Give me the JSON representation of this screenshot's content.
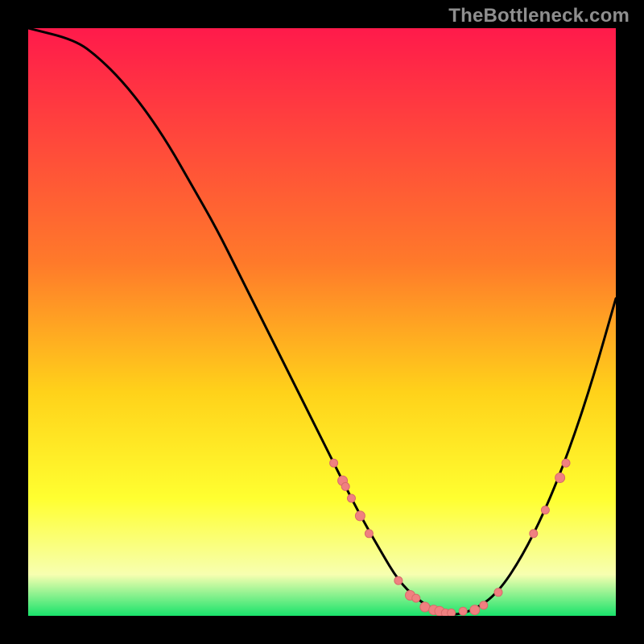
{
  "watermark": "TheBottleneck.com",
  "colors": {
    "gradient_top": "#ff1a4b",
    "gradient_b1": "#ff7a2a",
    "gradient_b2": "#ffd21a",
    "gradient_b3": "#ffff30",
    "gradient_b4": "#f7ffb0",
    "gradient_bottom": "#19e36b",
    "curve": "#000000",
    "marker_fill": "#f08080",
    "marker_stroke": "#d86a6a"
  },
  "chart_data": {
    "type": "line",
    "title": "",
    "xlabel": "",
    "ylabel": "",
    "xlim": [
      0,
      100
    ],
    "ylim": [
      0,
      100
    ],
    "curve": {
      "x": [
        0,
        8,
        12,
        16,
        20,
        24,
        28,
        32,
        36,
        40,
        44,
        48,
        52,
        56,
        60,
        63,
        66,
        69,
        72,
        76,
        80,
        84,
        88,
        92,
        96,
        100
      ],
      "y": [
        100,
        98,
        95,
        91,
        86,
        80,
        73,
        66,
        58,
        50,
        42,
        34,
        26,
        18,
        11,
        6,
        3,
        1,
        0,
        1,
        4,
        10,
        18,
        28,
        40,
        54
      ]
    },
    "markers": [
      {
        "x": 52.0,
        "y": 26.0,
        "r": 5
      },
      {
        "x": 53.5,
        "y": 23.0,
        "r": 6
      },
      {
        "x": 54.0,
        "y": 22.0,
        "r": 5
      },
      {
        "x": 55.0,
        "y": 20.0,
        "r": 5
      },
      {
        "x": 56.5,
        "y": 17.0,
        "r": 6
      },
      {
        "x": 58.0,
        "y": 14.0,
        "r": 5
      },
      {
        "x": 63.0,
        "y": 6.0,
        "r": 5
      },
      {
        "x": 65.0,
        "y": 3.5,
        "r": 6
      },
      {
        "x": 66.0,
        "y": 3.0,
        "r": 5
      },
      {
        "x": 67.5,
        "y": 1.5,
        "r": 6
      },
      {
        "x": 69.0,
        "y": 1.0,
        "r": 6
      },
      {
        "x": 70.0,
        "y": 0.8,
        "r": 6
      },
      {
        "x": 71.0,
        "y": 0.5,
        "r": 5
      },
      {
        "x": 72.0,
        "y": 0.5,
        "r": 5
      },
      {
        "x": 74.0,
        "y": 0.8,
        "r": 5
      },
      {
        "x": 76.0,
        "y": 1.0,
        "r": 6
      },
      {
        "x": 77.5,
        "y": 1.8,
        "r": 5
      },
      {
        "x": 80.0,
        "y": 4.0,
        "r": 5
      },
      {
        "x": 86.0,
        "y": 14.0,
        "r": 5
      },
      {
        "x": 88.0,
        "y": 18.0,
        "r": 5
      },
      {
        "x": 90.5,
        "y": 23.5,
        "r": 6
      },
      {
        "x": 91.5,
        "y": 26.0,
        "r": 5
      }
    ]
  }
}
